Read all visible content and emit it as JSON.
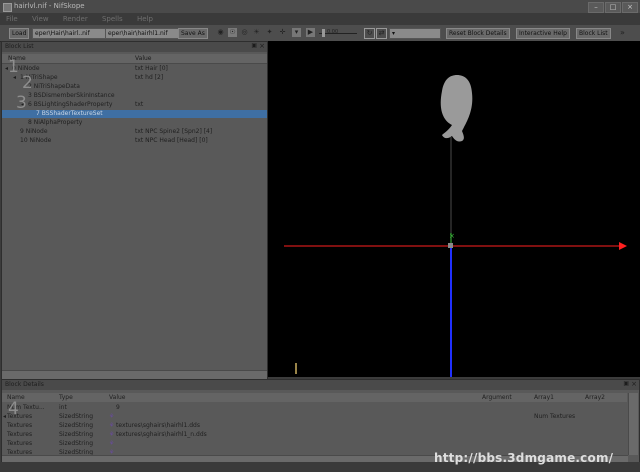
{
  "window": {
    "title_left": "hairlvl.nif",
    "title_right": "NifSkope",
    "minimize": "–",
    "maximize": "□",
    "close": "×"
  },
  "menu": [
    "File",
    "View",
    "Render",
    "Spells",
    "Help"
  ],
  "toolbar": {
    "load_label": "Load",
    "load_path": "eper\\Hair\\hairl..nif",
    "save_path": "eper\\hair\\hairhl1.nif",
    "saveas_label": "Save As",
    "slider_value": "0.00",
    "reset_block_label": "Reset Block Details",
    "interactive_help_label": "Interactive Help",
    "block_list_label": "Block List"
  },
  "block_list": {
    "title": "Block List",
    "col_name": "Name",
    "col_value": "Value",
    "rows": [
      {
        "indent": 0,
        "toggle": "◂",
        "name": "0 NiNode",
        "value": "txt Hair [0]",
        "selected": false
      },
      {
        "indent": 1,
        "toggle": "◂",
        "name": "1 NiTriShape",
        "value": "txt hd [2]",
        "selected": false
      },
      {
        "indent": 2,
        "toggle": "",
        "name": "2 NiTriShapeData",
        "value": "",
        "selected": false
      },
      {
        "indent": 2,
        "toggle": "",
        "name": "3 BSDismemberSkinInstance",
        "value": "",
        "selected": false
      },
      {
        "indent": 2,
        "toggle": "◂",
        "name": "6 BSLightingShaderProperty",
        "value": "txt",
        "selected": false
      },
      {
        "indent": 3,
        "toggle": "",
        "name": "7 BSShaderTextureSet",
        "value": "",
        "selected": true
      },
      {
        "indent": 2,
        "toggle": "",
        "name": "8 NiAlphaProperty",
        "value": "",
        "selected": false
      },
      {
        "indent": 1,
        "toggle": "",
        "name": "9 NiNode",
        "value": "txt NPC Spine2 [Spn2] [4]",
        "selected": false
      },
      {
        "indent": 1,
        "toggle": "",
        "name": "10 NiNode",
        "value": "txt NPC Head [Head] [0]",
        "selected": false
      }
    ]
  },
  "block_details": {
    "title": "Block Details",
    "columns": [
      "Name",
      "Type",
      "Value",
      "Argument",
      "Array1",
      "Array2"
    ],
    "rows": [
      {
        "name": "Num Textu...",
        "type": "int",
        "value": "9",
        "array1": ""
      },
      {
        "name": "Textures",
        "type": "SizedString",
        "value": "",
        "array1": "Num Textures"
      },
      {
        "name": "Textures",
        "type": "SizedString",
        "value": "textures\\sghairs\\hairhl1.dds",
        "array1": ""
      },
      {
        "name": "Textures",
        "type": "SizedString",
        "value": "textures\\sghairs\\hairhl1_n.dds",
        "array1": ""
      },
      {
        "name": "Textures",
        "type": "SizedString",
        "value": "",
        "array1": ""
      },
      {
        "name": "Textures",
        "type": "SizedString",
        "value": "",
        "array1": ""
      }
    ]
  },
  "annotations": [
    "1",
    "2",
    "3",
    "4"
  ],
  "watermark": "http://bbs.3dmgame.com/",
  "colors": {
    "selection": "#3f6fa3",
    "axis_x": "#ff2020",
    "axis_y": "#3fbf3f",
    "axis_z": "#2040ff",
    "model": "#9a9a9a"
  }
}
